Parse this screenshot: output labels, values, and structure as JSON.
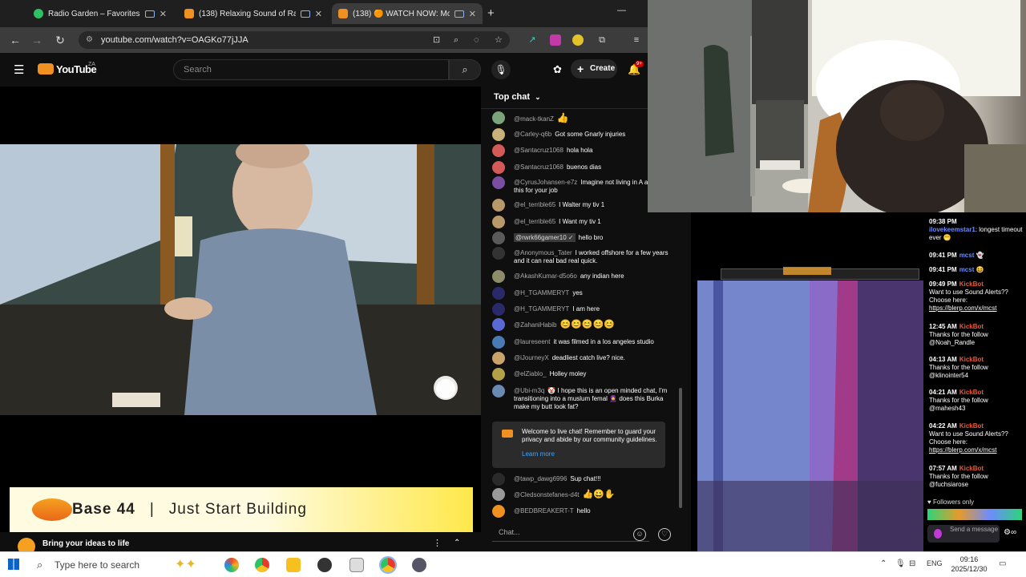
{
  "browser": {
    "tabs": [
      {
        "label": "Radio Garden – Favorites",
        "color": "#2dc263",
        "active": false
      },
      {
        "label": "(138) Relaxing Sound of Ra",
        "color": "#f09020",
        "active": false
      },
      {
        "label": "(138) 🟠 WATCH NOW: Mo",
        "color": "#f09020",
        "active": true
      }
    ],
    "new_tab": "+",
    "minimize": "—",
    "url": "youtube.com/watch?v=OAGKo77jJJA"
  },
  "youtube": {
    "logo": "YouTube",
    "region": "ZA",
    "search_placeholder": "Search",
    "create_label": "Create",
    "notif_count": "9+",
    "ad": {
      "brand": "Base 44",
      "separator": "|",
      "tagline": "Just Start Building",
      "below_text": "Bring your ideas to life"
    }
  },
  "chat": {
    "header": "Top chat",
    "messages": [
      {
        "author": "@mack-tkanZ",
        "text": "👍",
        "avatar": "#7aa37a"
      },
      {
        "author": "@Carley-q6b",
        "text": "Got some Gnarly injuries",
        "avatar": "#c9b27a"
      },
      {
        "author": "@Santacruz1068",
        "text": "hola hola",
        "avatar": "#d45a5a"
      },
      {
        "author": "@Santacruz1068",
        "text": "buenos dias",
        "avatar": "#d45a5a"
      },
      {
        "author": "@CyrusJohansen-e7z",
        "text": "Imagine not living in A and doing this for your job",
        "avatar": "#7a4ea0"
      },
      {
        "author": "@el_terrible65",
        "text": "I Walter my tiv 1",
        "avatar": "#b89a6a"
      },
      {
        "author": "@el_terrible65",
        "text": "I Want my tiv 1",
        "avatar": "#b89a6a"
      },
      {
        "author": "@rwrk66gamer10 ✓",
        "text": "hello bro",
        "avatar": "#5a5a5a"
      },
      {
        "author": "@Anonymous_Tater",
        "text": "I worked offshore for a few years and it can real bad real quick.",
        "avatar": "#333333"
      },
      {
        "author": "@AkashKumar-d5o6o",
        "text": "any indian here",
        "avatar": "#8c8c6a"
      },
      {
        "author": "@H_TGAMMERYT",
        "text": "yes",
        "avatar": "#2a2a6a"
      },
      {
        "author": "@H_TGAMMERYT",
        "text": "I am here",
        "avatar": "#2a2a6a"
      },
      {
        "author": "@ZahaniHabib",
        "text": "😊😊😊😊😊",
        "avatar": "#5a6ad4"
      },
      {
        "author": "@laureseent",
        "text": "it was filmed in a los angeles studio",
        "avatar": "#4a7ab4"
      },
      {
        "author": "@iJourneyX",
        "text": "deadliest catch live? nice.",
        "avatar": "#c9a46a"
      },
      {
        "author": "@elZiablo_",
        "text": "Holley moley",
        "avatar": "#b4a048"
      },
      {
        "author": "@Ubi-m3q",
        "text": "🤡 I hope this is an open minded chat, I'm transitioning into a muslum femal 🧕 does this Burka make my butt look fat?",
        "avatar": "#6a8ab4"
      },
      {
        "author": "@tawp_dawg6996",
        "text": "Sup chat!!!",
        "avatar": "#2a2a2a"
      },
      {
        "author": "@Cledsonstefanes-d4t",
        "text": "👍😀✋",
        "avatar": "#9a9a9a"
      },
      {
        "author": "@BEDBREAKERT-T",
        "text": "hello",
        "avatar": "#f09020"
      }
    ],
    "welcome_text": "Welcome to live chat! Remember to guard your privacy and abide by our community guidelines.",
    "learn_more": "Learn more",
    "input_placeholder": "Chat...",
    "emoji_icon": "☺",
    "heart_icon": "♡"
  },
  "twitch": {
    "messages": [
      {
        "time": "09:38 PM",
        "user": "ilovekeemstar1",
        "text": ": longest timeout ever 😬"
      },
      {
        "time": "09:41 PM",
        "user": "mcst",
        "text": "👻"
      },
      {
        "time": "09:41 PM",
        "user": "mcst",
        "text": "😆"
      },
      {
        "time": "09:49 PM",
        "user": "KickBot",
        "text": "Want to use Sound Alerts?? Choose here:",
        "link": "https://blerp.com/x/mcst"
      },
      {
        "time": "12:45 AM",
        "user": "KickBot",
        "text": "Thanks for the follow @Noah_Randle"
      },
      {
        "time": "04:13 AM",
        "user": "KickBot",
        "text": "Thanks for the follow @klinointer54"
      },
      {
        "time": "04:21 AM",
        "user": "KickBot",
        "text": "Thanks for the follow @mahesh43"
      },
      {
        "time": "04:22 AM",
        "user": "KickBot",
        "text": "Want to use Sound Alerts?? Choose here:",
        "link": "https://blerp.com/x/mcst"
      },
      {
        "time": "07:57 AM",
        "user": "KickBot",
        "text": "Thanks for the follow @fuchsiarose"
      }
    ],
    "followers_only": "♥ Followers only",
    "send_placeholder": "Send a message"
  },
  "taskbar": {
    "search_placeholder": "Type here to search",
    "lang": "ENG",
    "time": "09:16",
    "date": "2025/12/30"
  }
}
